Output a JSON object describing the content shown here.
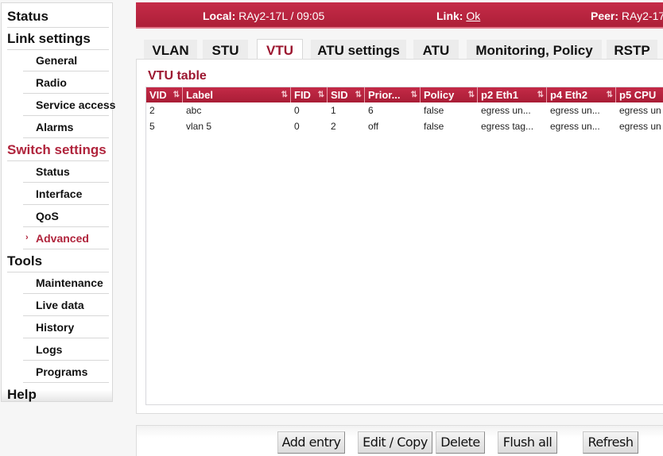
{
  "sidebar": {
    "items": [
      {
        "label": "Status",
        "level": "top"
      },
      {
        "label": "Link settings",
        "level": "top"
      },
      {
        "label": "General",
        "level": "sub"
      },
      {
        "label": "Radio",
        "level": "sub"
      },
      {
        "label": "Service access",
        "level": "sub"
      },
      {
        "label": "Alarms",
        "level": "sub"
      },
      {
        "label": "Switch settings",
        "level": "top",
        "active": true
      },
      {
        "label": "Status",
        "level": "sub"
      },
      {
        "label": "Interface",
        "level": "sub"
      },
      {
        "label": "QoS",
        "level": "sub"
      },
      {
        "label": "Advanced",
        "level": "sub",
        "active": true
      },
      {
        "label": "Tools",
        "level": "top"
      },
      {
        "label": "Maintenance",
        "level": "sub"
      },
      {
        "label": "Live data",
        "level": "sub"
      },
      {
        "label": "History",
        "level": "sub"
      },
      {
        "label": "Logs",
        "level": "sub"
      },
      {
        "label": "Programs",
        "level": "sub"
      },
      {
        "label": "Help",
        "level": "top"
      }
    ],
    "active_marker": "›"
  },
  "header": {
    "local_label": "Local:",
    "local_value": "RAy2-17L / 09:05",
    "link_label": "Link:",
    "link_value": "Ok",
    "peer_label": "Peer:",
    "peer_value": "RAy2-17"
  },
  "tabs": [
    {
      "label": "VLAN"
    },
    {
      "label": "STU"
    },
    {
      "label": "VTU",
      "active": true
    },
    {
      "label": "ATU settings"
    },
    {
      "label": "ATU"
    },
    {
      "label": "Monitoring, Policy"
    },
    {
      "label": "RSTP"
    }
  ],
  "table": {
    "title": "VTU table",
    "sort_icon": "⇅",
    "columns": [
      "VID",
      "Label",
      "FID",
      "SID",
      "Prior...",
      "Policy",
      "p2 Eth1",
      "p4 Eth2",
      "p5 CPU"
    ],
    "rows": [
      [
        "2",
        "abc",
        "0",
        "1",
        "6",
        "false",
        "egress un...",
        "egress un...",
        "egress un"
      ],
      [
        "5",
        "vlan 5",
        "0",
        "2",
        "off",
        "false",
        "egress tag...",
        "egress un...",
        "egress un"
      ]
    ]
  },
  "buttons": {
    "add": "Add entry",
    "edit": "Edit / Copy",
    "delete": "Delete",
    "flush": "Flush all",
    "refresh": "Refresh"
  },
  "colors": {
    "brand": "#b0243c",
    "header_bg": "#c52b48"
  }
}
